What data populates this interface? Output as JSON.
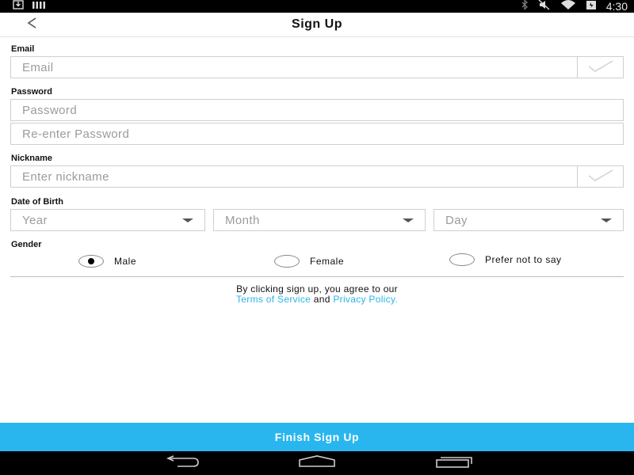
{
  "status_bar": {
    "time": "4:30",
    "icons": [
      "download-icon",
      "bars-icon",
      "bluetooth-icon",
      "mute-icon",
      "wifi-icon",
      "battery-icon"
    ]
  },
  "header": {
    "title": "Sign Up",
    "back_icon": "back-arrow-icon"
  },
  "form": {
    "email": {
      "label": "Email",
      "placeholder": "Email",
      "value": ""
    },
    "password": {
      "label": "Password",
      "placeholder": "Password",
      "confirm_placeholder": "Re-enter Password"
    },
    "nickname": {
      "label": "Nickname",
      "placeholder": "Enter nickname"
    },
    "dob": {
      "label": "Date of Birth",
      "year": "Year",
      "month": "Month",
      "day": "Day"
    },
    "gender": {
      "label": "Gender",
      "options": [
        "Male",
        "Female",
        "Prefer not to say"
      ],
      "selected": "Male"
    }
  },
  "terms": {
    "line1": "By clicking sign up, you agree to our",
    "tos": "Terms of Service",
    "and": "and",
    "privacy": "Privacy Policy."
  },
  "finish_button": "Finish Sign Up",
  "colors": {
    "accent": "#29b6ef",
    "link": "#29b6e8",
    "status_bar": "#000000"
  }
}
